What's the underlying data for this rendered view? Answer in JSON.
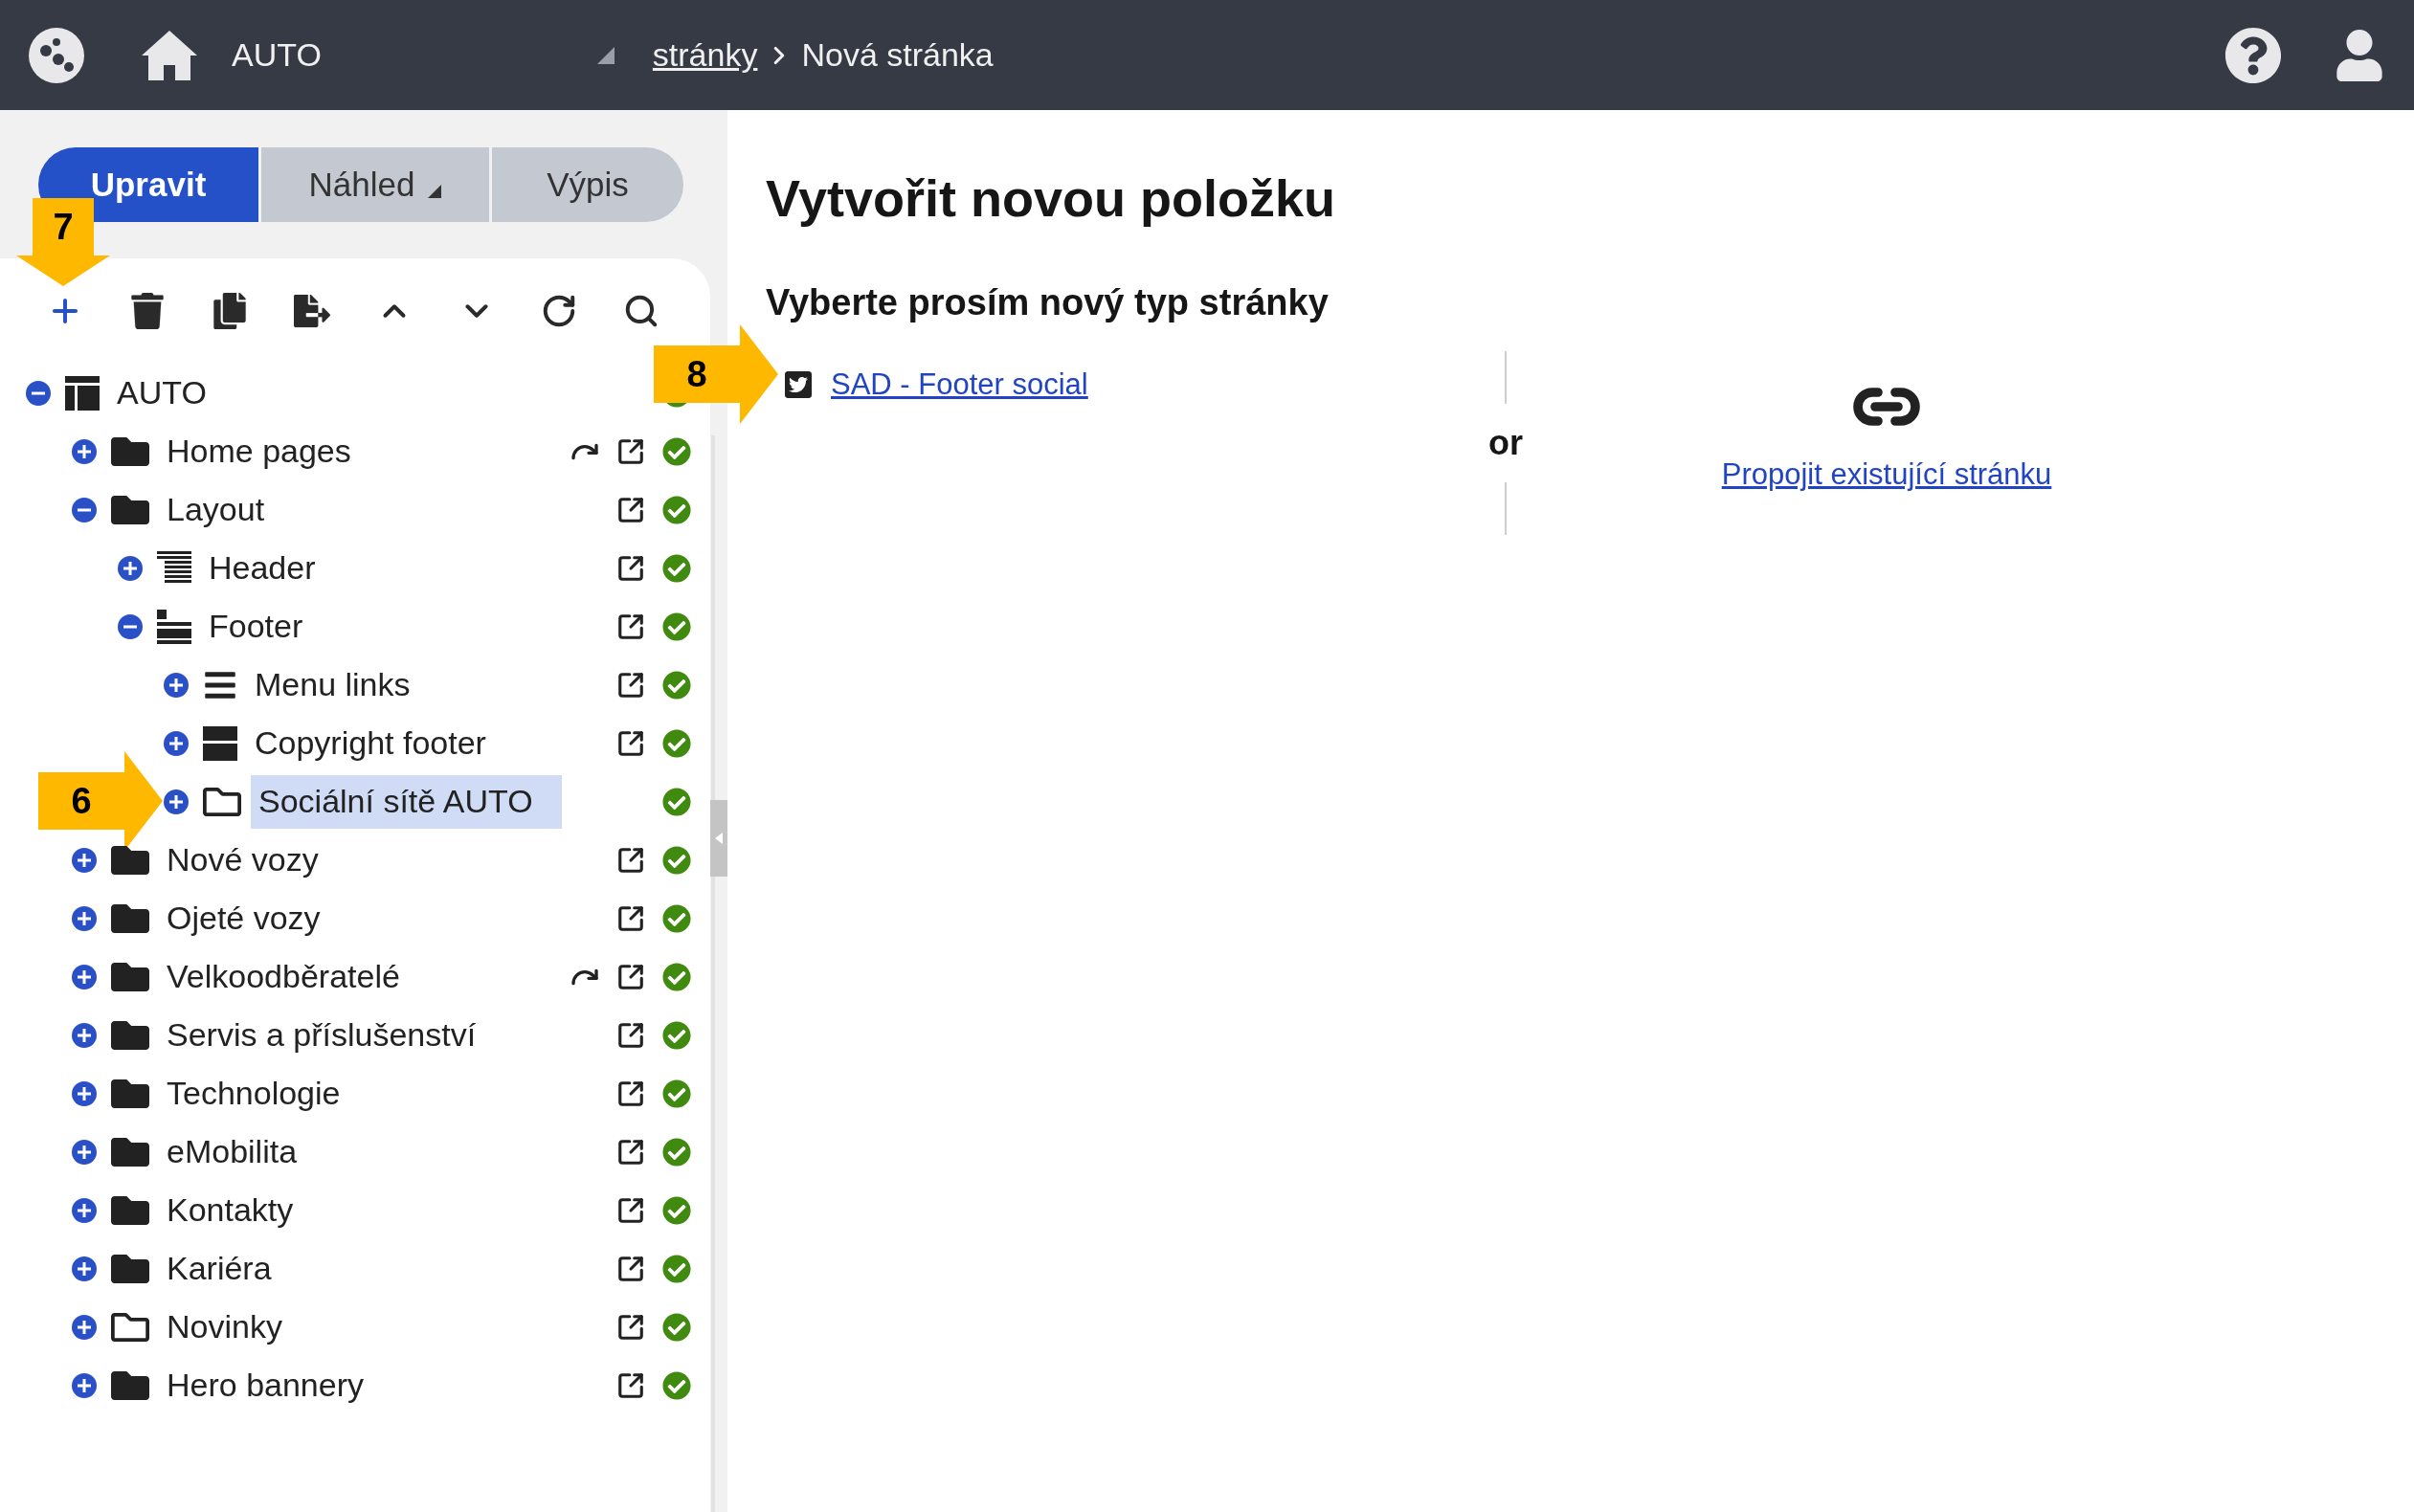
{
  "topbar": {
    "site": "AUTO",
    "breadcrumb": [
      {
        "label": "stránky",
        "link": true
      },
      {
        "label": "Nová stránka",
        "link": false
      }
    ]
  },
  "tabs": [
    {
      "label": "Upravit",
      "selected": true,
      "dropdown": false
    },
    {
      "label": "Náhled",
      "selected": false,
      "dropdown": true
    },
    {
      "label": "Výpis",
      "selected": false,
      "dropdown": false
    }
  ],
  "toolbar": [
    {
      "kind": "add",
      "callout": "7"
    },
    {
      "kind": "delete"
    },
    {
      "kind": "copy"
    },
    {
      "kind": "move"
    },
    {
      "kind": "up"
    },
    {
      "kind": "down"
    },
    {
      "kind": "refresh"
    },
    {
      "kind": "search"
    }
  ],
  "tree": [
    {
      "label": "AUTO",
      "kind": "layout",
      "expanded": true,
      "selected": false,
      "redirect": false,
      "external_link": false,
      "published": true,
      "children": [
        {
          "label": "Home pages",
          "kind": "folder",
          "expanded": false,
          "selected": false,
          "redirect": true,
          "external_link": true,
          "published": true
        },
        {
          "label": "Layout",
          "kind": "folder",
          "expanded": true,
          "selected": false,
          "redirect": false,
          "external_link": true,
          "published": true,
          "children": [
            {
              "label": "Header",
              "kind": "header",
              "expanded": false,
              "selected": false,
              "redirect": false,
              "external_link": true,
              "published": true
            },
            {
              "label": "Footer",
              "kind": "footer",
              "expanded": true,
              "selected": false,
              "redirect": false,
              "external_link": true,
              "published": true,
              "children": [
                {
                  "label": "Menu links",
                  "kind": "menu",
                  "expanded": false,
                  "selected": false,
                  "redirect": false,
                  "external_link": true,
                  "published": true
                },
                {
                  "label": "Copyright footer",
                  "kind": "block",
                  "expanded": false,
                  "selected": false,
                  "redirect": false,
                  "external_link": true,
                  "published": true
                },
                {
                  "label": "Sociální sítě AUTO",
                  "kind": "folder-empty",
                  "expanded": false,
                  "selected": true,
                  "redirect": false,
                  "external_link": false,
                  "published": true,
                  "callout": "6"
                }
              ]
            }
          ]
        },
        {
          "label": "Nové vozy",
          "kind": "folder",
          "expanded": false,
          "selected": false,
          "redirect": false,
          "external_link": true,
          "published": true
        },
        {
          "label": "Ojeté vozy",
          "kind": "folder",
          "expanded": false,
          "selected": false,
          "redirect": false,
          "external_link": true,
          "published": true
        },
        {
          "label": "Velkoodběratelé",
          "kind": "folder",
          "expanded": false,
          "selected": false,
          "redirect": true,
          "external_link": true,
          "published": true
        },
        {
          "label": "Servis a příslušenství",
          "kind": "folder",
          "expanded": false,
          "selected": false,
          "redirect": false,
          "external_link": true,
          "published": true
        },
        {
          "label": "Technologie",
          "kind": "folder",
          "expanded": false,
          "selected": false,
          "redirect": false,
          "external_link": true,
          "published": true
        },
        {
          "label": "eMobilita",
          "kind": "folder",
          "expanded": false,
          "selected": false,
          "redirect": false,
          "external_link": true,
          "published": true
        },
        {
          "label": "Kontakty",
          "kind": "folder",
          "expanded": false,
          "selected": false,
          "redirect": false,
          "external_link": true,
          "published": true
        },
        {
          "label": "Kariéra",
          "kind": "folder",
          "expanded": false,
          "selected": false,
          "redirect": false,
          "external_link": true,
          "published": true
        },
        {
          "label": "Novinky",
          "kind": "folder-empty",
          "expanded": false,
          "selected": false,
          "redirect": false,
          "external_link": true,
          "published": true
        },
        {
          "label": "Hero bannery",
          "kind": "folder",
          "expanded": false,
          "selected": false,
          "redirect": false,
          "external_link": true,
          "published": true
        }
      ]
    }
  ],
  "content": {
    "title": "Vytvořit novou položku",
    "subtitle": "Vyberte prosím nový typ stránky",
    "page_types": [
      {
        "label": "SAD - Footer social",
        "kind": "twitter",
        "callout": "8"
      }
    ],
    "separator": "or",
    "link_existing": "Propojit existující stránku"
  }
}
